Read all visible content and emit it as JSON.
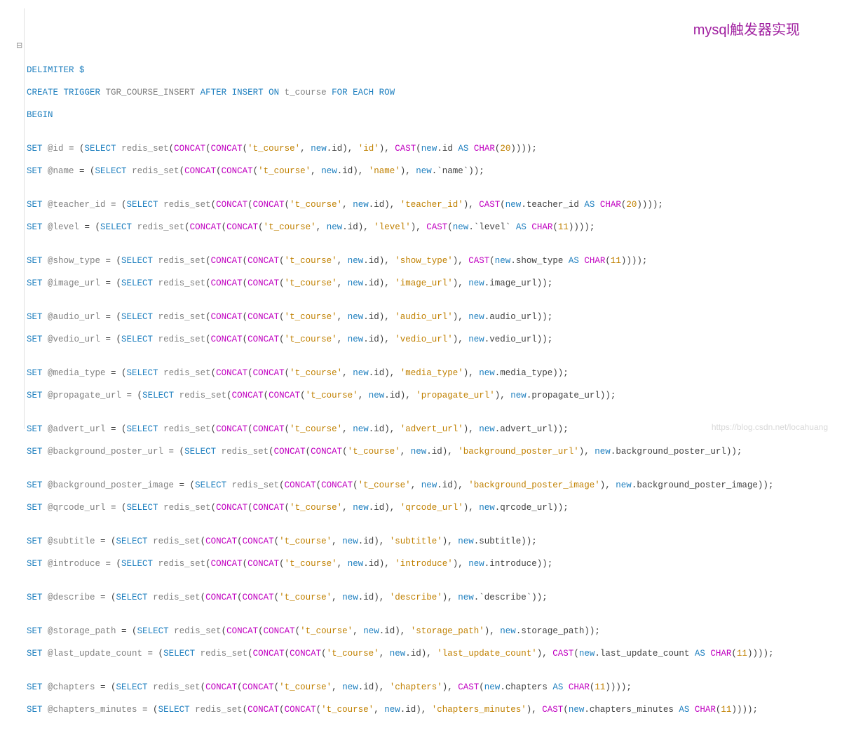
{
  "annotation": "mysql触发器实现",
  "watermark": "https://blog.csdn.net/locahuang",
  "code": {
    "l1": "DELIMITER $",
    "l2": {
      "a": "CREATE TRIGGER ",
      "b": "TGR_COURSE_INSERT ",
      "c": "AFTER INSERT ON ",
      "d": "t_course ",
      "e": "FOR EACH ROW"
    },
    "l3": "BEGIN",
    "set": "SET ",
    "sel": "SELECT ",
    "rs": "redis_set",
    "cc": "CONCAT",
    "cast": "CAST",
    "as": " AS ",
    "char": "CHAR",
    "new": "new",
    "tc": "'t_course'",
    "n20": "20",
    "n11": "11",
    "vars": {
      "id": "@id",
      "name": "@name",
      "teacher_id": "@teacher_id",
      "level": "@level",
      "show_type": "@show_type",
      "image_url": "@image_url",
      "audio_url": "@audio_url",
      "vedio_url": "@vedio_url",
      "media_type": "@media_type",
      "propagate_url": "@propagate_url",
      "advert_url": "@advert_url",
      "background_poster_url": "@background_poster_url",
      "background_poster_image": "@background_poster_image",
      "qrcode_url": "@qrcode_url",
      "subtitle": "@subtitle",
      "introduce": "@introduce",
      "describe": "@describe",
      "storage_path": "@storage_path",
      "last_update_count": "@last_update_count",
      "chapters": "@chapters",
      "chapters_minutes": "@chapters_minutes"
    },
    "keys": {
      "id": "'id'",
      "name": "'name'",
      "teacher_id": "'teacher_id'",
      "level": "'level'",
      "show_type": "'show_type'",
      "image_url": "'image_url'",
      "audio_url": "'audio_url'",
      "vedio_url": "'vedio_url'",
      "media_type": "'media_type'",
      "propagate_url": "'propagate_url'",
      "advert_url": "'advert_url'",
      "background_poster_url": "'background_poster_url'",
      "background_poster_image": "'background_poster_image'",
      "qrcode_url": "'qrcode_url'",
      "subtitle": "'subtitle'",
      "introduce": "'introduce'",
      "describe": "'describe'",
      "storage_path": "'storage_path'",
      "last_update_count": "'last_update_count'",
      "chapters": "'chapters'",
      "chapters_minutes": "'chapters_minutes'"
    },
    "fields": {
      "id": ".id",
      "name": ".`name`",
      "teacher_id": ".teacher_id",
      "level": ".`level`",
      "show_type": ".show_type",
      "image_url": ".image_url",
      "audio_url": ".audio_url",
      "vedio_url": ".vedio_url",
      "media_type": ".media_type",
      "propagate_url": ".propagate_url",
      "advert_url": ".advert_url",
      "background_poster_url": ".background_poster_url",
      "background_poster_image": ".background_poster_image",
      "qrcode_url": ".qrcode_url",
      "subtitle": ".subtitle",
      "introduce": ".introduce",
      "describe": ".`describe`",
      "storage_path": ".storage_path",
      "last_update_count": ".last_update_count",
      "chapters": ".chapters",
      "chapters_minutes": ".chapters_minutes"
    }
  }
}
